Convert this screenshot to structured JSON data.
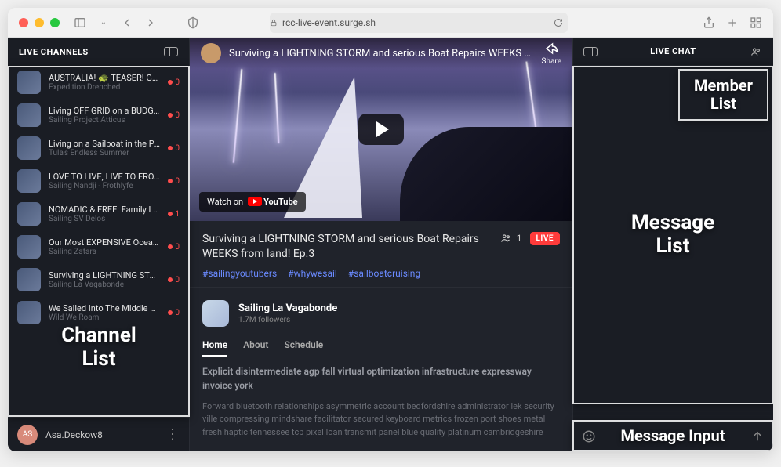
{
  "browser": {
    "url": "rcc-live-event.surge.sh"
  },
  "sidebar_left": {
    "header": "LIVE CHANNELS"
  },
  "channels": [
    {
      "title": "AUSTRALIA! 🐢 TEASER! Get ready…",
      "subtitle": "Expedition Drenched",
      "viewers": "0"
    },
    {
      "title": "Living OFF GRID on a BUDGET Sail…",
      "subtitle": "Sailing Project Atticus",
      "viewers": "0"
    },
    {
      "title": "Living on a Sailboat in the Pacifi…",
      "subtitle": "Tula's Endless Summer",
      "viewers": "0"
    },
    {
      "title": "LOVE TO LIVE, LIVE TO FROTH - Sa…",
      "subtitle": "Sailing Nandji - Frothlyfe",
      "viewers": "0"
    },
    {
      "title": "NOMADIC & FREE: Family Life at S…",
      "subtitle": "Sailing SV Delos",
      "viewers": "1"
    },
    {
      "title": "Our Most EXPENSIVE Ocean Cross…",
      "subtitle": "Sailing Zatara",
      "viewers": "0"
    },
    {
      "title": "Surviving a LIGHTNING STORM an…",
      "subtitle": "Sailing La Vagabonde",
      "viewers": "0"
    },
    {
      "title": "We Sailed Into The Middle Of Th…",
      "subtitle": "Wild We Roam",
      "viewers": "0"
    }
  ],
  "user": {
    "initials": "AS",
    "name": "Asa.Deckow8"
  },
  "video": {
    "top_title": "Surviving a LIGHTNING STORM and serious Boat Repairs WEEKS fr…",
    "share": "Share",
    "watch_on": "Watch on",
    "yt_text": "YouTube",
    "title": "Surviving a LIGHTNING STORM and serious Boat Repairs WEEKS from land! Ep.3",
    "viewers": "1",
    "live": "LIVE",
    "tags": [
      "#sailingyoutubers",
      "#whywesail",
      "#sailboatcruising"
    ]
  },
  "channel_info": {
    "name": "Sailing La Vagabonde",
    "followers": "1.7M followers"
  },
  "tabs": [
    {
      "label": "Home",
      "active": true
    },
    {
      "label": "About",
      "active": false
    },
    {
      "label": "Schedule",
      "active": false
    }
  ],
  "description": {
    "bold": "Explicit disintermediate agp fall virtual optimization infrastructure expressway invoice york",
    "body": "Forward bluetooth relationships asymmetric account bedfordshire administrator lek security ville compressing mindshare facilitator secured keyboard metrics frozen port shoes metal fresh haptic tennessee tcp pixel loan transmit panel blue quality platinum cambridgeshire"
  },
  "chat": {
    "header": "LIVE CHAT"
  },
  "annotations": {
    "channel_list": "Channel\nList",
    "member_list": "Member\nList",
    "message_list": "Message\nList",
    "message_input": "Message Input"
  }
}
